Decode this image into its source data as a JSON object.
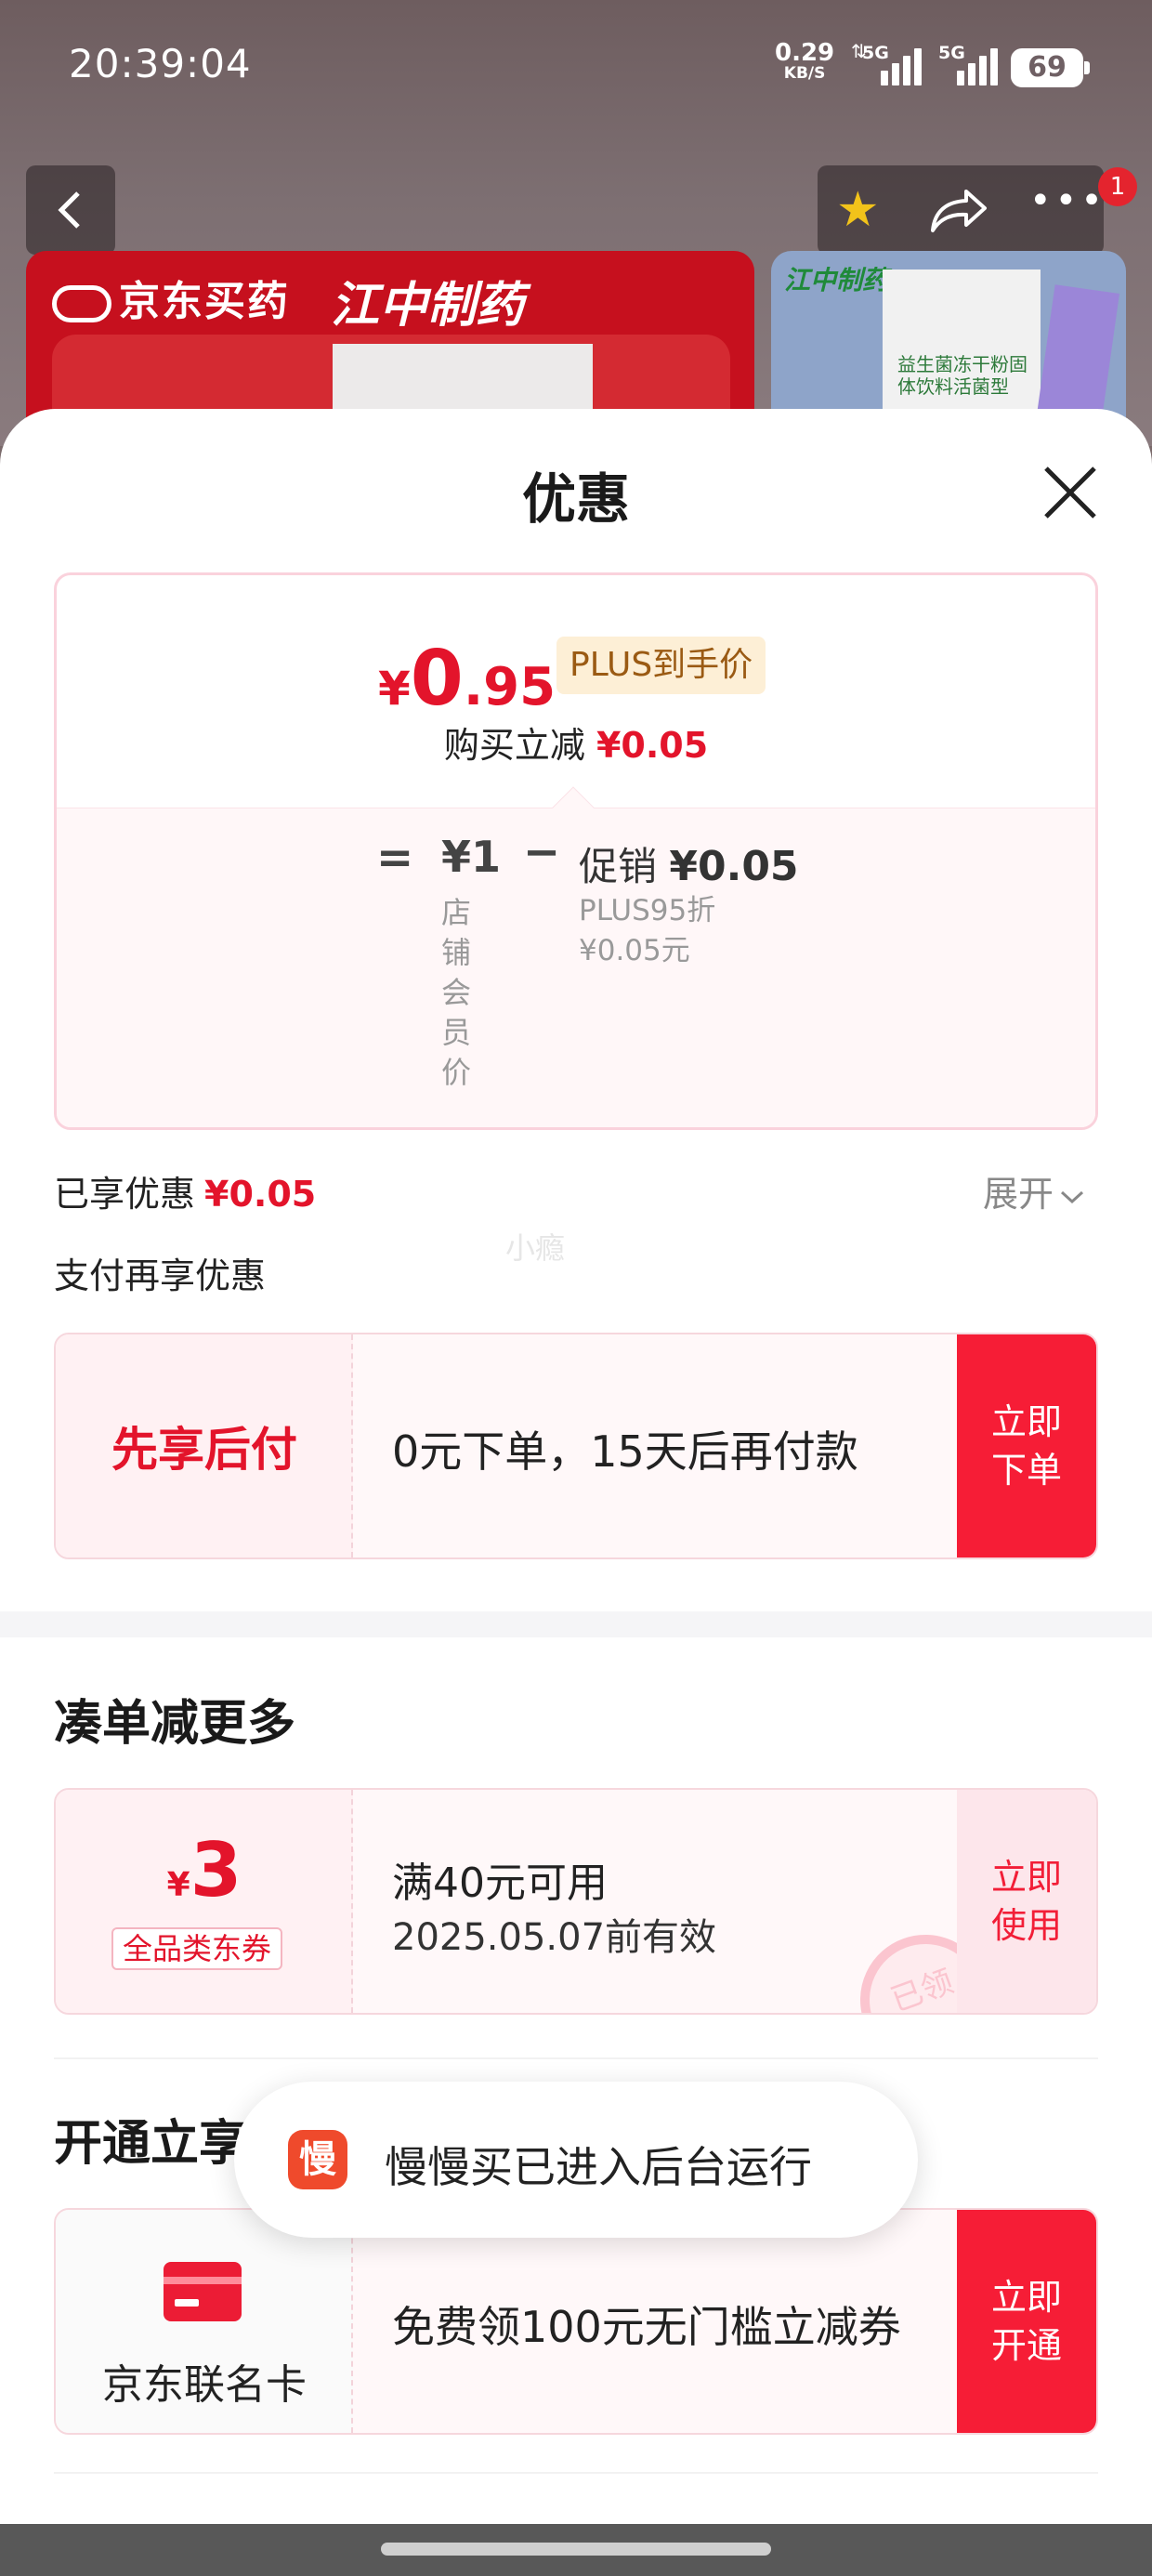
{
  "status_bar": {
    "time": "20:39:04",
    "net_speed": "0.29",
    "net_unit": "KB/S",
    "signal1_gen": "5G",
    "signal2_gen": "5G",
    "battery": "69"
  },
  "top_nav": {
    "cart_badge": "1"
  },
  "banner": {
    "store_logo": "京东买药",
    "brand": "江中制药",
    "side_brand": "江中制药",
    "product_text": "益生菌冻干粉固体饮料活菌型"
  },
  "sheet": {
    "title": "优惠"
  },
  "price": {
    "currency": "¥",
    "plus_price_int": "0",
    "plus_price_dec": ".95",
    "plus_tag": "PLUS到手价",
    "buy_reduce_label": "购买立减",
    "buy_reduce_value": "¥0.05",
    "equals": "=",
    "original": "¥1",
    "original_label": "店铺会员价",
    "minus": "−",
    "promo_label": "促销",
    "promo_value": "¥0.05",
    "promo_sub1": "PLUS95折",
    "promo_sub2": "¥0.05元"
  },
  "enjoyed": {
    "label": "已享优惠",
    "value": "¥0.05",
    "expand": "展开"
  },
  "watermark": "小瘾",
  "pay": {
    "section_label": "支付再享优惠",
    "bnpl_title": "先享后付",
    "bnpl_desc": "0元下单，15天后再付款",
    "bnpl_button": "立即下单"
  },
  "more": {
    "section_title": "凑单减更多",
    "coupon_currency": "¥",
    "coupon_amount": "3",
    "coupon_tag": "全品类东券",
    "coupon_condition": "满40元可用",
    "coupon_expiry": "2025.05.07前有效",
    "coupon_button": "立即使用",
    "stamp": "已领"
  },
  "open": {
    "section_title": "开通立享",
    "card_label": "京东联名卡",
    "card_desc": "免费领100元无门槛立减券",
    "card_button": "立即开通"
  },
  "toast": {
    "icon_char": "慢",
    "message": "慢慢买已进入后台运行"
  },
  "colors": {
    "accent_red": "#e3142b",
    "button_red": "#f61d36",
    "plus_gold": "#9a5a13"
  }
}
